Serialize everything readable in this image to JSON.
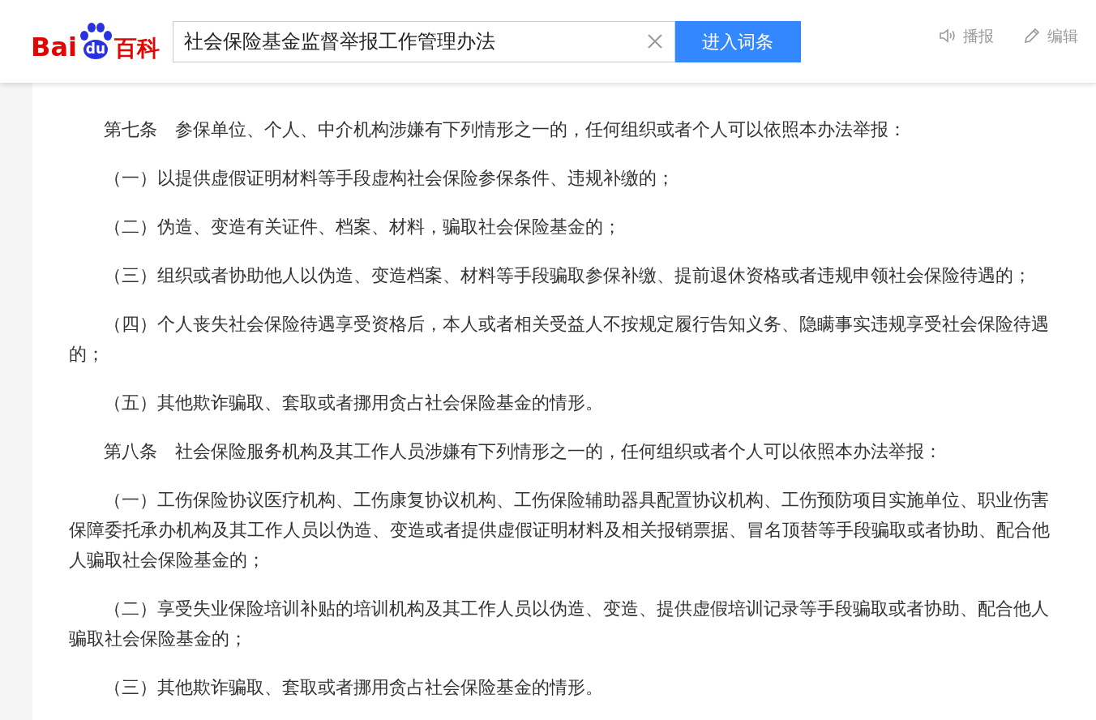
{
  "header": {
    "logo": {
      "left": "Bai",
      "badge": "du",
      "right": "百科"
    },
    "search": {
      "value": "社会保险基金监督举报工作管理办法"
    },
    "button": "进入词条",
    "actions": [
      {
        "kind": "speaker",
        "label": "播报"
      },
      {
        "kind": "pencil",
        "label": "编辑"
      }
    ]
  },
  "paragraphs": [
    "第七条　参保单位、个人、中介机构涉嫌有下列情形之一的，任何组织或者个人可以依照本办法举报：",
    "（一）以提供虚假证明材料等手段虚构社会保险参保条件、违规补缴的；",
    "（二）伪造、变造有关证件、档案、材料，骗取社会保险基金的；",
    "（三）组织或者协助他人以伪造、变造档案、材料等手段骗取参保补缴、提前退休资格或者违规申领社会保险待遇的；",
    "（四）个人丧失社会保险待遇享受资格后，本人或者相关受益人不按规定履行告知义务、隐瞒事实违规享受社会保险待遇的；",
    "（五）其他欺诈骗取、套取或者挪用贪占社会保险基金的情形。",
    "第八条　社会保险服务机构及其工作人员涉嫌有下列情形之一的，任何组织或者个人可以依照本办法举报：",
    "（一）工伤保险协议医疗机构、工伤康复协议机构、工伤保险辅助器具配置协议机构、工伤预防项目实施单位、职业伤害保障委托承办机构及其工作人员以伪造、变造或者提供虚假证明材料及相关报销票据、冒名顶替等手段骗取或者协助、配合他人骗取社会保险基金的；",
    "（二）享受失业保险培训补贴的培训机构及其工作人员以伪造、变造、提供虚假培训记录等手段骗取或者协助、配合他人骗取社会保险基金的；",
    "（三）其他欺诈骗取、套取或者挪用贪占社会保险基金的情形。"
  ]
}
